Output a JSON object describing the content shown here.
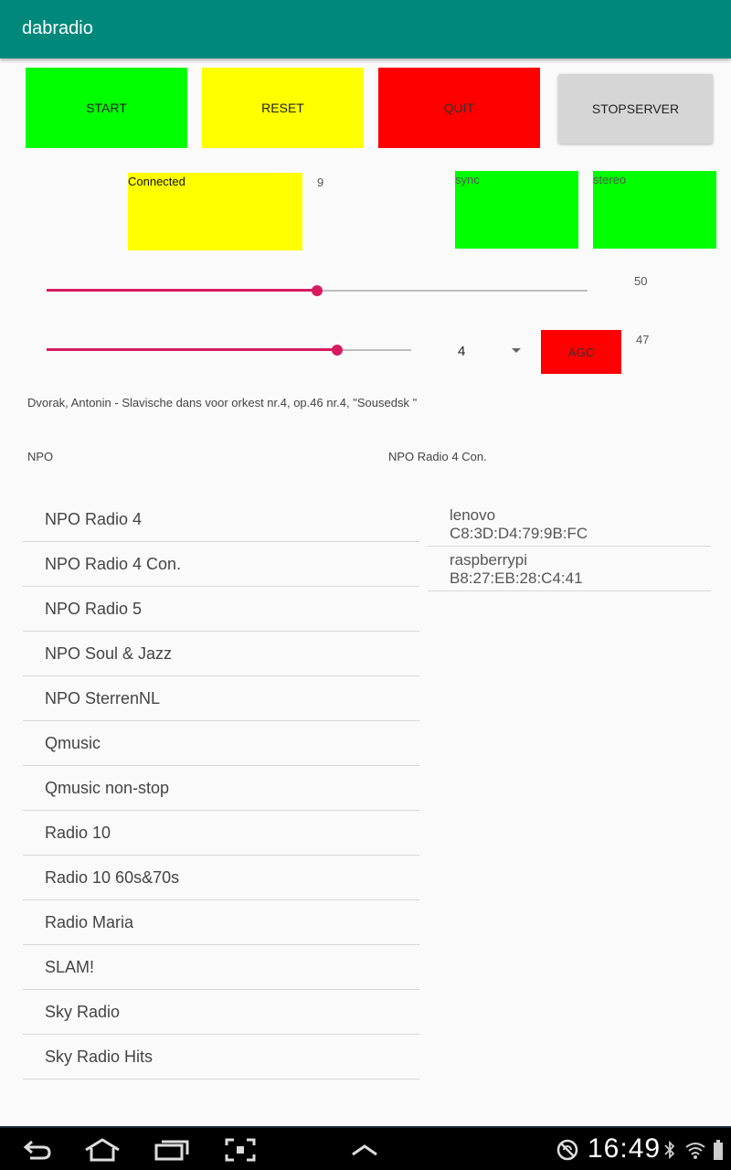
{
  "app": {
    "title": "dabradio"
  },
  "buttons": {
    "start": "START",
    "reset": "RESET",
    "quit": "QUIT",
    "stopserver": "STOPSERVER",
    "agc": "AGC"
  },
  "colors": {
    "appbar": "#00897b",
    "start": "#00ff00",
    "reset": "#ffff00",
    "quit": "#ff0000",
    "stopserver": "#d6d6d6",
    "accent": "#d81b60"
  },
  "status": {
    "connected": "Connected",
    "connected_count": "9",
    "sync": "sync",
    "stereo": "stereo"
  },
  "sliders": [
    {
      "value": 50,
      "max": 100,
      "label": "50"
    },
    {
      "value": 47,
      "max": 59,
      "label": "47"
    }
  ],
  "spinner": {
    "value": "4"
  },
  "now_playing": "Dvorak, Antonin - Slavische dans voor orkest nr.4, op.46 nr.4, \"Sousedsk  \"",
  "ensemble": "NPO",
  "current_station": "NPO Radio 4 Con.",
  "stations": [
    "NPO Radio 4",
    "NPO Radio 4 Con.",
    "NPO Radio 5",
    "NPO Soul & Jazz",
    "NPO SterrenNL",
    "Qmusic",
    "Qmusic non-stop",
    "Radio 10",
    "Radio 10 60s&70s",
    "Radio Maria",
    "SLAM!",
    "Sky Radio",
    "Sky Radio Hits"
  ],
  "devices": [
    {
      "name": "lenovo",
      "mac": "C8:3D:D4:79:9B:FC"
    },
    {
      "name": "raspberrypi",
      "mac": "B8:27:EB:28:C4:41"
    }
  ],
  "navbar": {
    "icons": [
      "back-icon",
      "home-icon",
      "recent-apps-icon",
      "screenshot-icon",
      "menu-up-icon"
    ],
    "status_icons": [
      "no-sync-icon",
      "bluetooth-icon",
      "wifi-icon",
      "battery-icon"
    ],
    "clock": "16:49"
  }
}
